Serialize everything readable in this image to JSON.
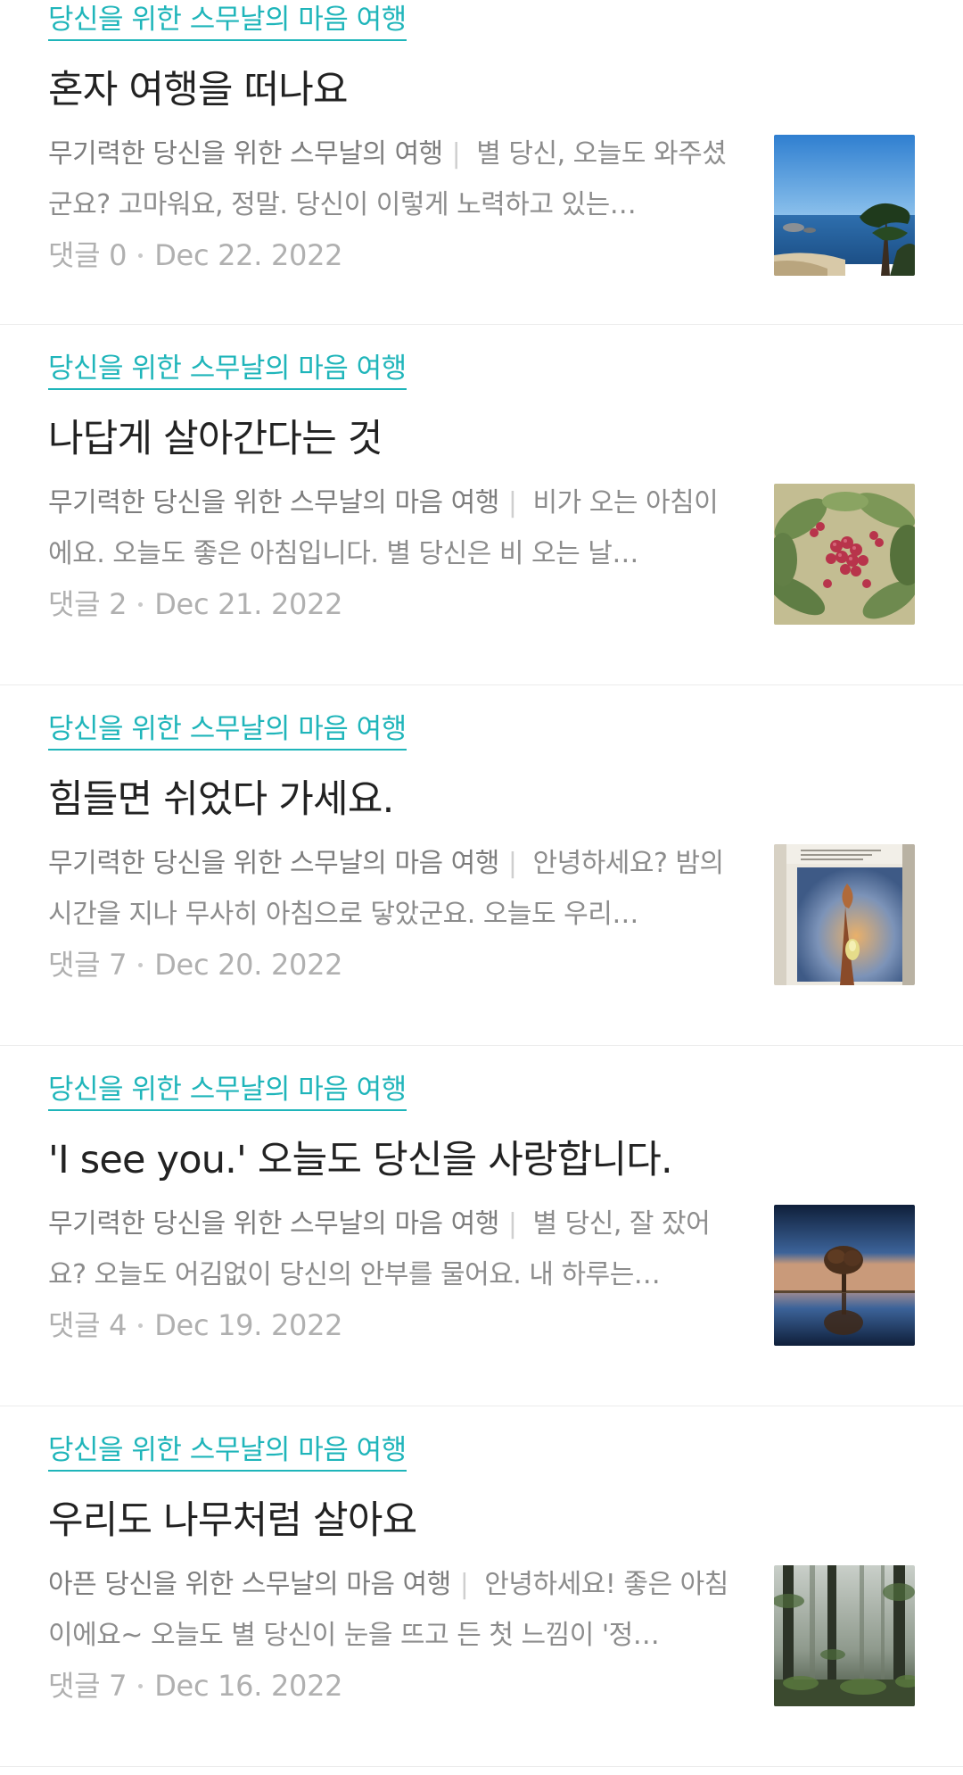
{
  "posts": [
    {
      "category": "당신을 위한 스무날의 마음 여행",
      "title": "혼자 여행을 떠나요",
      "summary_series": "무기력한 당신을 위한 스무날의 여행",
      "summary_text": "별 당신, 오늘도 와주셨군요? 고마워요, 정말. 당신이 이렇게 노력하고 있는…",
      "comments_label": "댓글",
      "comments_count": "0",
      "date": "Dec 22. 2022",
      "thumbnail": "seaside-coast-photo"
    },
    {
      "category": "당신을 위한 스무날의 마음 여행",
      "title": "나답게 살아간다는 것",
      "summary_series": "무기력한 당신을 위한 스무날의 마음 여행",
      "summary_text": "비가 오는 아침이에요. 오늘도 좋은 아침입니다. 별 당신은 비 오는 날…",
      "comments_label": "댓글",
      "comments_count": "2",
      "date": "Dec 21. 2022",
      "thumbnail": "red-berries-leaves-photo"
    },
    {
      "category": "당신을 위한 스무날의 마음 여행",
      "title": "힘들면 쉬었다 가세요.",
      "summary_series": "무기력한 당신을 위한 스무날의 마음 여행",
      "summary_text": "안녕하세요? 밤의 시간을 지나 무사히 아침으로 닿았군요. 오늘도 우리…",
      "comments_label": "댓글",
      "comments_count": "7",
      "date": "Dec 20. 2022",
      "thumbnail": "book-page-bud-photo"
    },
    {
      "category": "당신을 위한 스무날의 마음 여행",
      "title": "'I see you.' 오늘도 당신을 사랑합니다.",
      "summary_series": "무기력한 당신을 위한 스무날의 마음 여행",
      "summary_text": "별 당신, 잘 잤어요? 오늘도 어김없이 당신의 안부를 물어요. 내 하루는…",
      "comments_label": "댓글",
      "comments_count": "4",
      "date": "Dec 19. 2022",
      "thumbnail": "lone-tree-reflection-photo"
    },
    {
      "category": "당신을 위한 스무날의 마음 여행",
      "title": "우리도 나무처럼 살아요",
      "summary_series": "아픈 당신을 위한 스무날의 마음 여행",
      "summary_text": "안녕하세요! 좋은 아침이에요~ 오늘도 별 당신이 눈을 뜨고 든 첫 느낌이 '정…",
      "comments_label": "댓글",
      "comments_count": "7",
      "date": "Dec 16. 2022",
      "thumbnail": "misty-forest-photo"
    }
  ],
  "colors": {
    "accent": "#1fb5ba",
    "title": "#222222",
    "summary": "#8c8c8c",
    "meta": "#b0b0b0",
    "divider": "#ececec"
  }
}
